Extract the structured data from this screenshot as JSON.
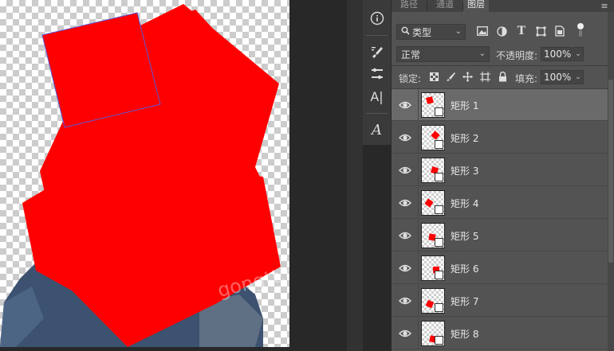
{
  "canvas": {
    "watermark": "gongtt.com"
  },
  "toolbar": {
    "tools": [
      {
        "name": "info-icon"
      },
      {
        "name": "brush-settings-icon"
      },
      {
        "name": "clone-source-icon"
      },
      {
        "name": "character-icon",
        "glyph": "A|"
      },
      {
        "name": "paragraph-style-icon",
        "glyph": "A"
      }
    ]
  },
  "layers_panel": {
    "tabs": [
      {
        "label": "路径"
      },
      {
        "label": "通道"
      },
      {
        "label": "图层",
        "active": true
      }
    ],
    "filter": {
      "label": "类型",
      "search_icon": "search-icon"
    },
    "blend_mode": "正常",
    "opacity_label": "不透明度:",
    "opacity_value": "100%",
    "lock_label": "锁定:",
    "fill_label": "填充:",
    "fill_value": "100%",
    "layers": [
      {
        "name": "矩形 1",
        "selected": true
      },
      {
        "name": "矩形 2"
      },
      {
        "name": "矩形 3"
      },
      {
        "name": "矩形 4"
      },
      {
        "name": "矩形 5"
      },
      {
        "name": "矩形 6"
      },
      {
        "name": "矩形 7"
      },
      {
        "name": "矩形 8"
      }
    ]
  },
  "colors": {
    "shape_red": "#ff0000",
    "panel_bg": "#535353",
    "selected_row": "#6a6a6a"
  }
}
